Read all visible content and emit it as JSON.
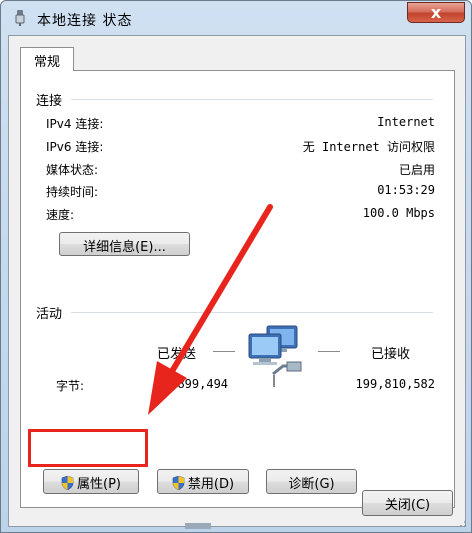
{
  "window": {
    "title": "本地连接 状态",
    "close_glyph": "x"
  },
  "tabs": [
    {
      "label": "常规"
    }
  ],
  "connection": {
    "section_label": "连接",
    "rows": [
      {
        "label": "IPv4 连接:",
        "value": "Internet"
      },
      {
        "label": "IPv6 连接:",
        "value": "无 Internet 访问权限"
      },
      {
        "label": "媒体状态:",
        "value": "已启用"
      },
      {
        "label": "持续时间:",
        "value": "01:53:29"
      },
      {
        "label": "速度:",
        "value": "100.0 Mbps"
      }
    ],
    "details_button": "详细信息(E)..."
  },
  "activity": {
    "section_label": "活动",
    "sent_label": "已发送",
    "received_label": "已接收",
    "bytes_label": "字节:",
    "bytes_sent": "7,899,494",
    "bytes_received": "199,810,582",
    "icon": "network-computers-icon"
  },
  "actions": {
    "properties_button": "属性(P)",
    "disable_button": "禁用(D)",
    "diagnose_button": "诊断(G)"
  },
  "footer": {
    "close_button": "关闭(C)"
  },
  "colors": {
    "annotation_red": "#e8251d",
    "titlebar": "#c4d8ee",
    "close_button": "#c1432d"
  }
}
